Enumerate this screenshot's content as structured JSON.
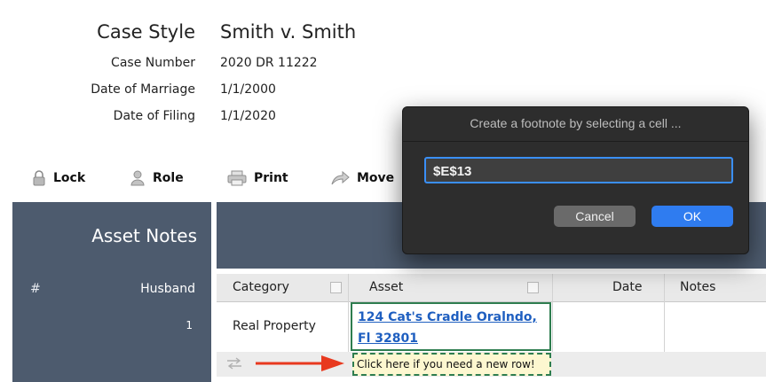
{
  "case_info": {
    "style_label": "Case Style",
    "style_value": "Smith v. Smith",
    "number_label": "Case Number",
    "number_value": "2020 DR 11222",
    "marriage_label": "Date of Marriage",
    "marriage_value": "1/1/2000",
    "filing_label": "Date of Filing",
    "filing_value": "1/1/2020"
  },
  "toolbar": {
    "lock": "Lock",
    "role": "Role",
    "print": "Print",
    "move": "Move"
  },
  "left_panel": {
    "title": "Asset Notes",
    "col_hash": "#",
    "col_husband": "Husband",
    "row_number": "1"
  },
  "table": {
    "headers": {
      "category": "Category",
      "asset": "Asset",
      "date": "Date",
      "notes": "Notes"
    },
    "row": {
      "category": "Real Property",
      "asset": "124 Cat's Cradle Oralndo, Fl 32801"
    },
    "new_row_hint": "Click here if you need a new row!"
  },
  "dialog": {
    "title": "Create a footnote by selecting a cell ...",
    "input_value": "$E$13",
    "cancel": "Cancel",
    "ok": "OK"
  },
  "colors": {
    "panel": "#4d5b6e",
    "link": "#1f5fc0",
    "selection": "#2e7d4f",
    "accent": "#2f7cf0",
    "arrow": "#e8391f"
  }
}
